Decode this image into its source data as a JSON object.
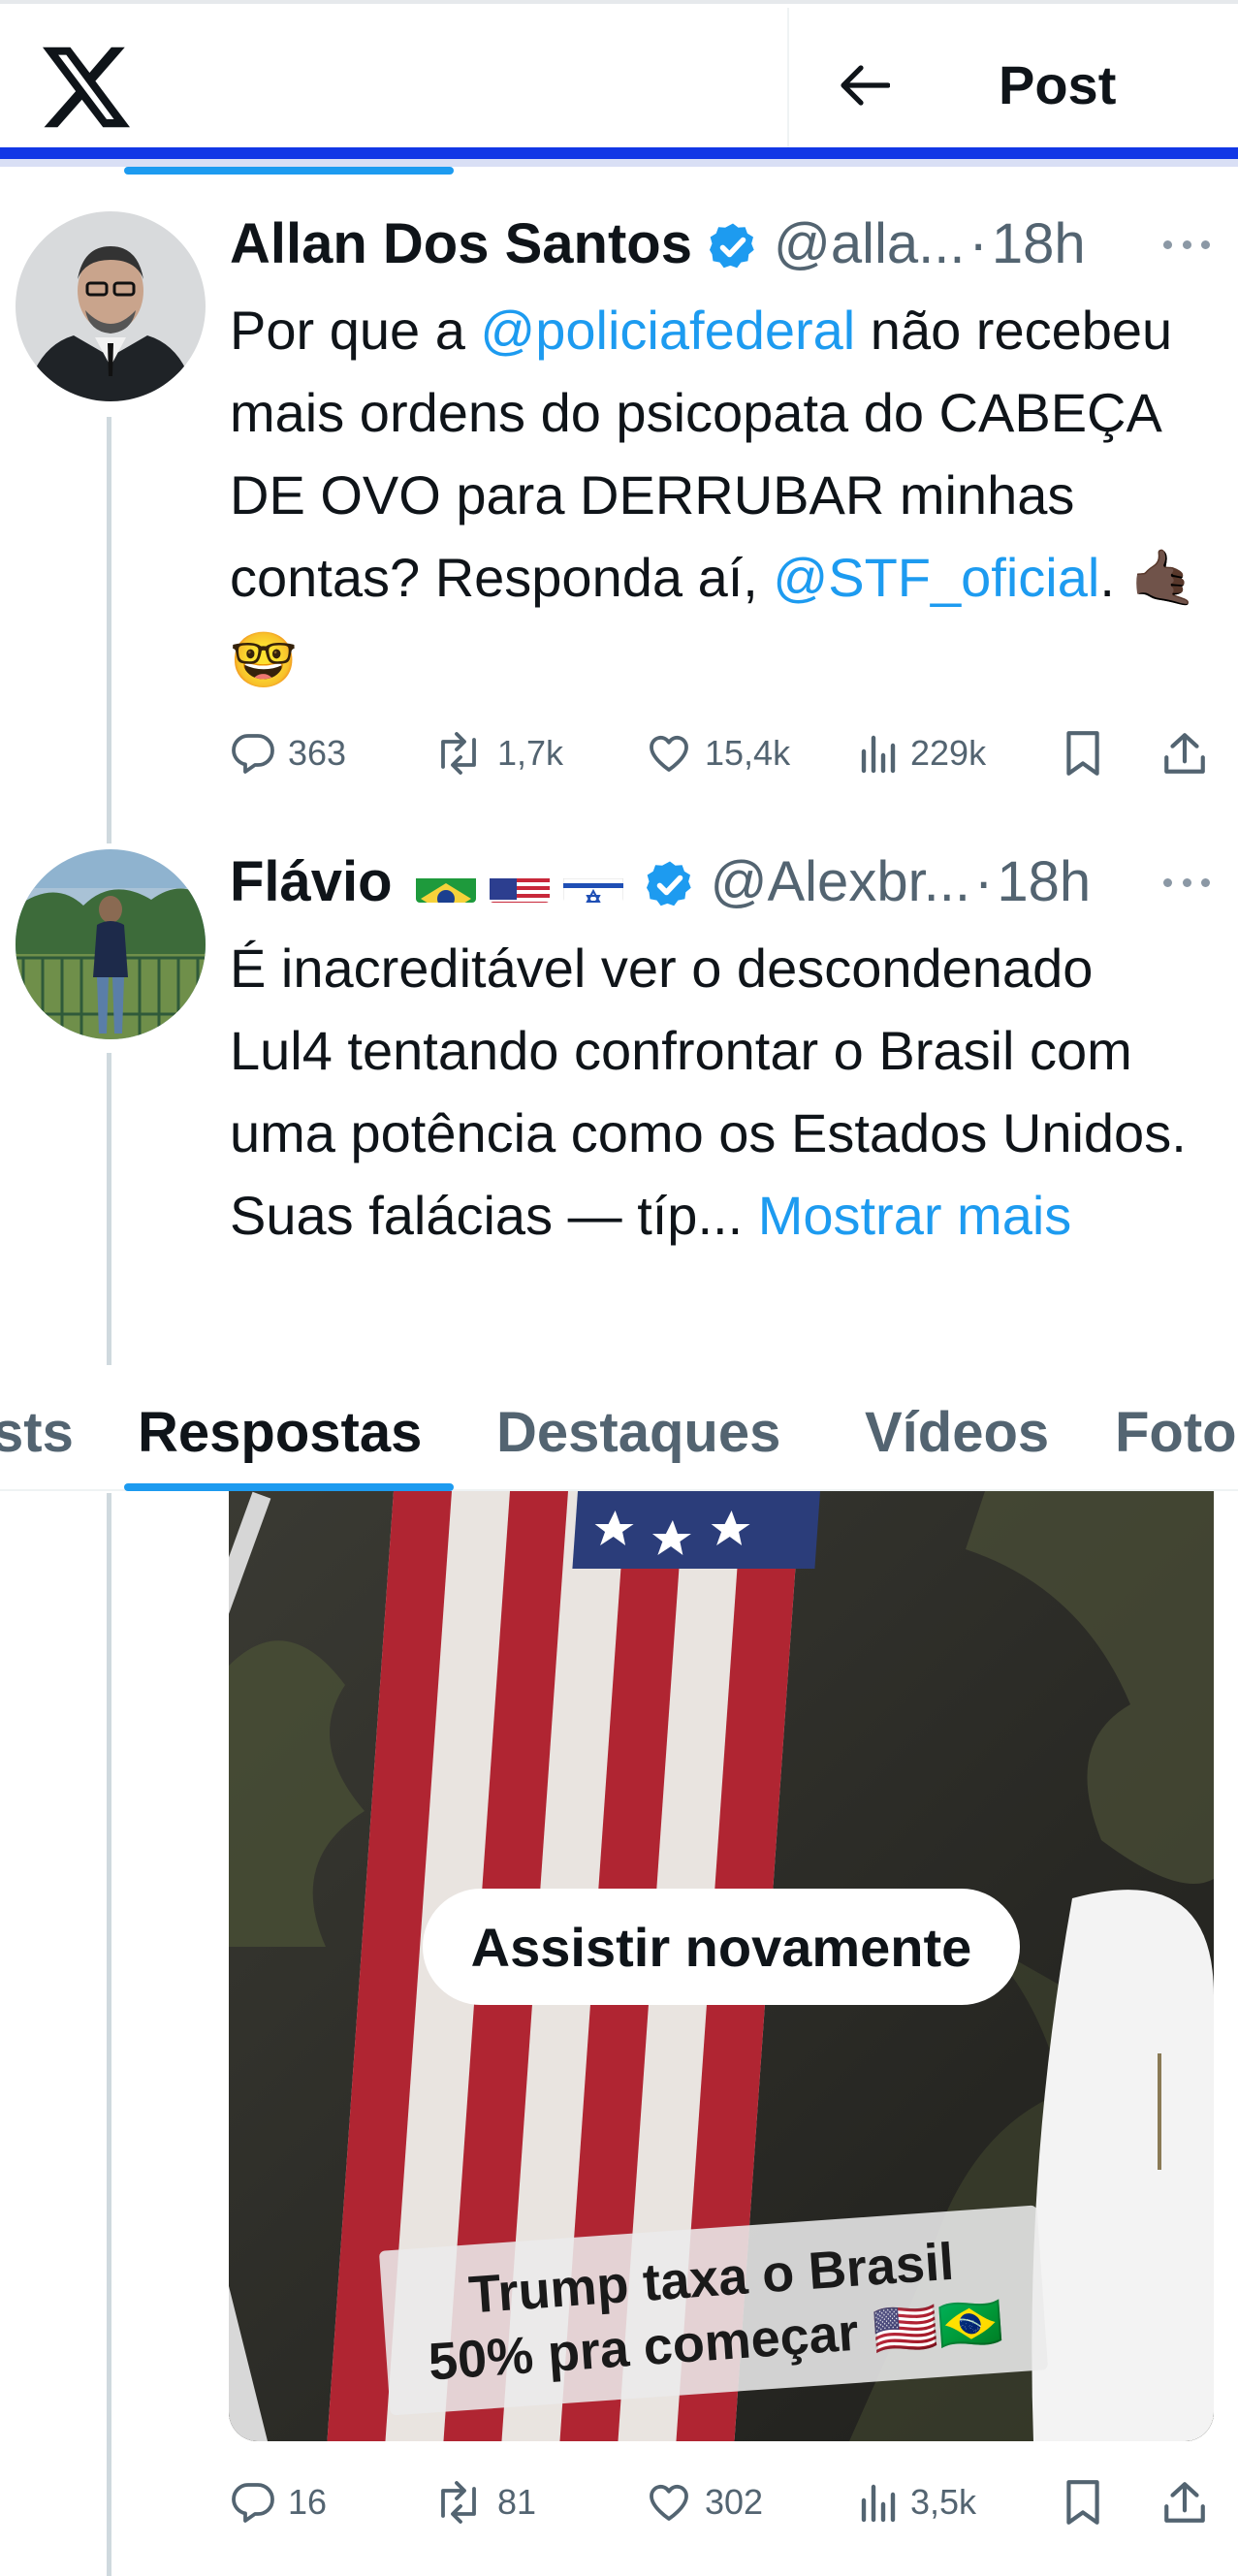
{
  "header": {
    "title": "Post"
  },
  "tweets": [
    {
      "author": "Allan Dos Santos",
      "handle": "@alla...",
      "separator": "·",
      "time": "18h",
      "text": {
        "p1": "Por que a ",
        "mention1": "@policiafederal",
        "p2": " não recebeu mais ordens do psicopata do CABEÇA DE OVO para DERRUBAR minhas contas? Responda aí, ",
        "mention2": "@STF_oficial",
        "p3": ". 🤙🏿🤓"
      },
      "stats": {
        "replies": "363",
        "reposts": "1,7k",
        "likes": "15,4k",
        "views": "229k"
      }
    },
    {
      "author": "Flávio",
      "flags": [
        "brazil-flag",
        "usa-flag",
        "israel-flag"
      ],
      "handle": "@Alexbr...",
      "separator": "·",
      "time": "18h",
      "text": {
        "p1": "É inacreditável ver o descondenado Lul4 tentando confrontar o Brasil com uma potência como os Estados Unidos. Suas falácias — típ...",
        "show_more": " Mostrar mais"
      },
      "media": {
        "replay_label": "Assistir novamente",
        "caption_line1": "Trump taxa o Brasil",
        "caption_line2": "50% pra começar 🇺🇸🇧🇷"
      },
      "stats": {
        "replies": "16",
        "reposts": "81",
        "likes": "302",
        "views": "3,5k"
      }
    }
  ],
  "tabs": [
    "sts",
    "Respostas",
    "Destaques",
    "Vídeos",
    "Foto"
  ],
  "active_tab": "Respostas",
  "colors": {
    "accent": "#1d9bf0",
    "text": "#0f1419",
    "muted": "#536471",
    "header_bar": "#1237e6"
  }
}
